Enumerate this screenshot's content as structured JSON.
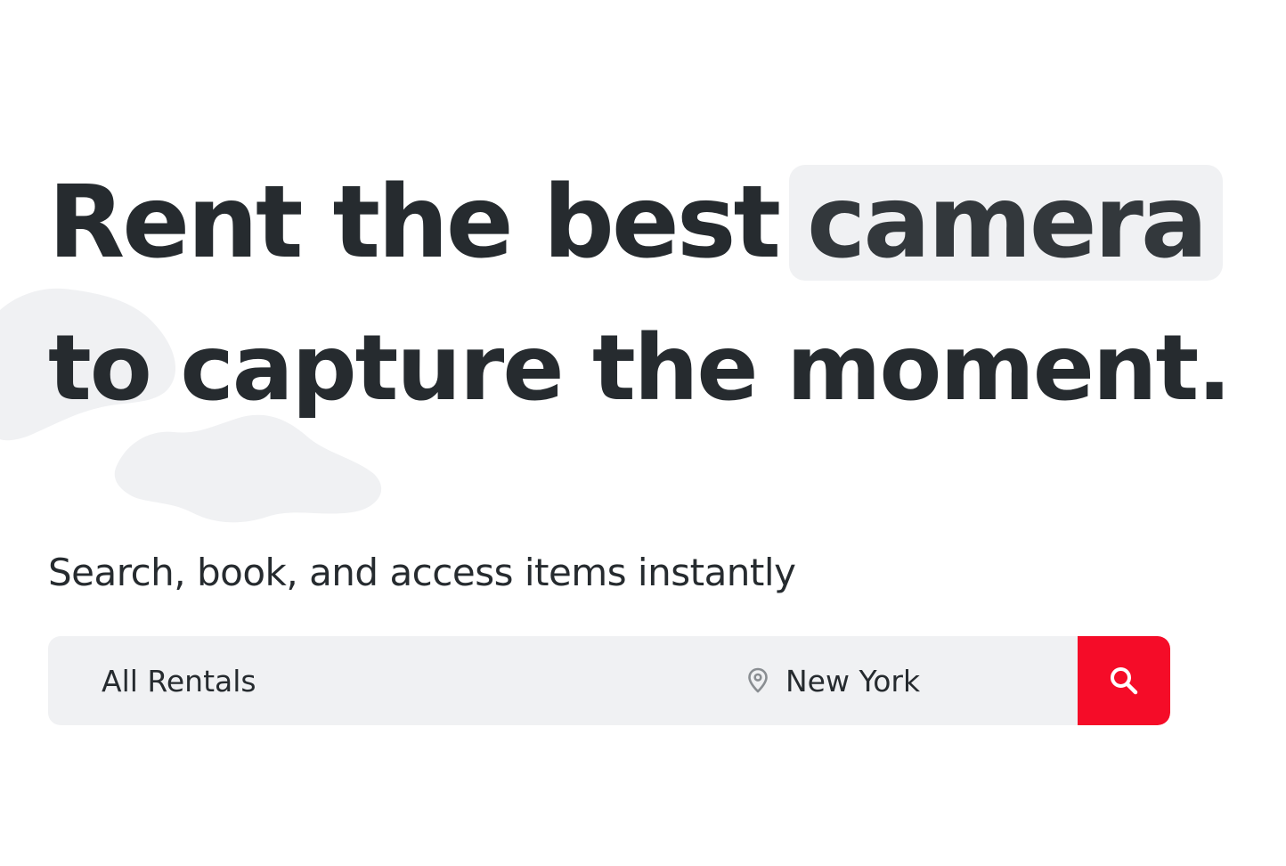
{
  "hero": {
    "headline_part1": "Rent the best",
    "headline_highlight": "camera",
    "headline_line2": "to capture the moment.",
    "subtitle": "Search, book, and access items instantly"
  },
  "search": {
    "category_value": "All Rentals",
    "location_value": "New York",
    "location_icon": "map-pin-icon",
    "button_icon": "search-icon"
  },
  "colors": {
    "text": "#262b2f",
    "highlight_bg": "#f0f1f3",
    "search_bg": "#f0f1f3",
    "accent": "#f50c28",
    "blob": "#f0f1f3"
  }
}
